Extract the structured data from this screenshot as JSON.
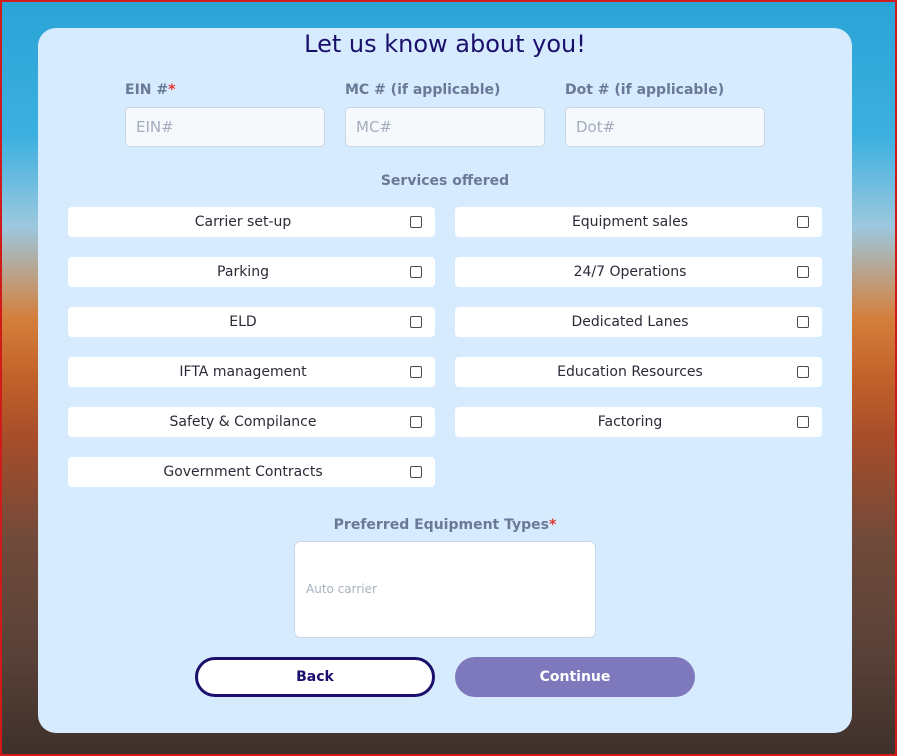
{
  "form": {
    "title": "Let us know about you!",
    "ein": {
      "label": "EIN #",
      "required_mark": "*",
      "placeholder": "EIN#",
      "value": ""
    },
    "mc": {
      "label": "MC # (if applicable)",
      "placeholder": "MC#",
      "value": ""
    },
    "dot": {
      "label": "Dot # (if applicable)",
      "placeholder": "Dot#",
      "value": ""
    },
    "services_label": "Services offered",
    "services": [
      {
        "label": "Carrier set-up",
        "checked": false
      },
      {
        "label": "Equipment sales",
        "checked": false
      },
      {
        "label": "Parking",
        "checked": false
      },
      {
        "label": "24/7 Operations",
        "checked": false
      },
      {
        "label": "ELD",
        "checked": false
      },
      {
        "label": "Dedicated Lanes",
        "checked": false
      },
      {
        "label": "IFTA management",
        "checked": false
      },
      {
        "label": "Education Resources",
        "checked": false
      },
      {
        "label": "Safety & Compilance",
        "checked": false
      },
      {
        "label": "Factoring",
        "checked": false
      },
      {
        "label": "Government Contracts",
        "checked": false
      }
    ],
    "equipment": {
      "label": "Preferred Equipment Types",
      "required_mark": "*",
      "placeholder": "Auto carrier",
      "value": ""
    },
    "back_label": "Back",
    "continue_label": "Continue"
  },
  "colors": {
    "title": "#1b0f6c",
    "card": "#d6ebfd",
    "continue_button": "#7e78bd",
    "required": "#e03535"
  }
}
